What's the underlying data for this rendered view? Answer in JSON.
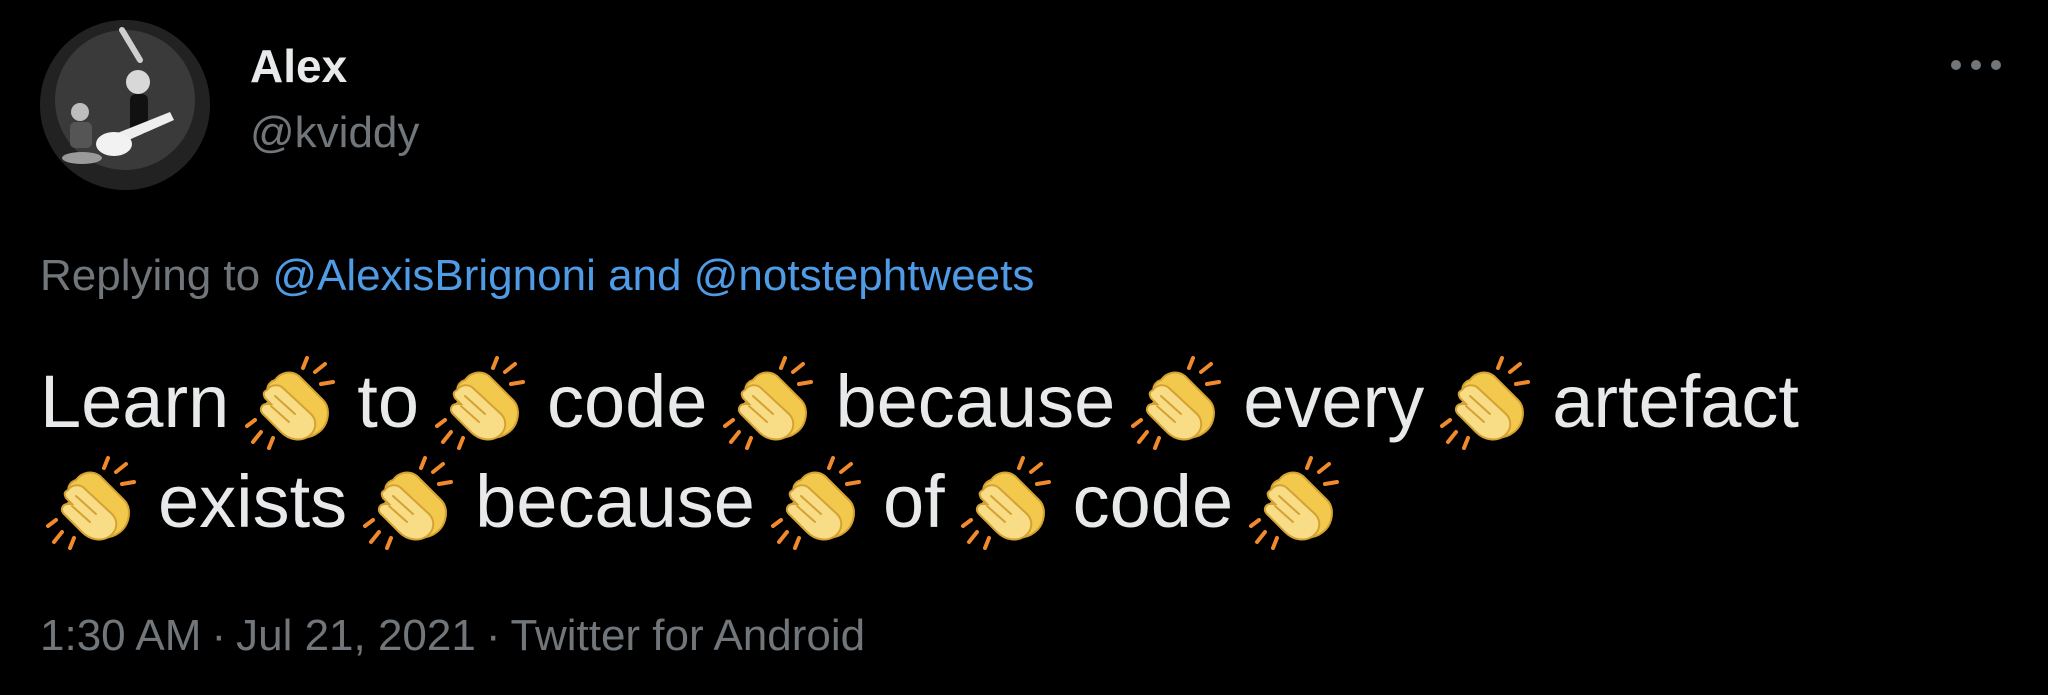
{
  "author": {
    "display_name": "Alex",
    "handle": "@kviddy"
  },
  "reply_context": {
    "prefix": "Replying to",
    "mentions": [
      "@AlexisBrignoni",
      "@notstephtweets"
    ],
    "joiner": "and"
  },
  "tweet": {
    "line1": [
      "Learn",
      "to",
      "code",
      "because",
      "every",
      "artefact"
    ],
    "line2": [
      "exists",
      "because",
      "of",
      "code"
    ],
    "emoji": "clapping-hands-icon"
  },
  "meta": {
    "time": "1:30 AM",
    "date": "Jul 21, 2021",
    "source": "Twitter for Android",
    "separator": "·"
  },
  "colors": {
    "background": "#000000",
    "text": "#e7e9ea",
    "secondary": "#71767b",
    "mention": "#4f9be6",
    "clap_fill": "#f6d77a",
    "clap_lines": "#f08a2c"
  }
}
